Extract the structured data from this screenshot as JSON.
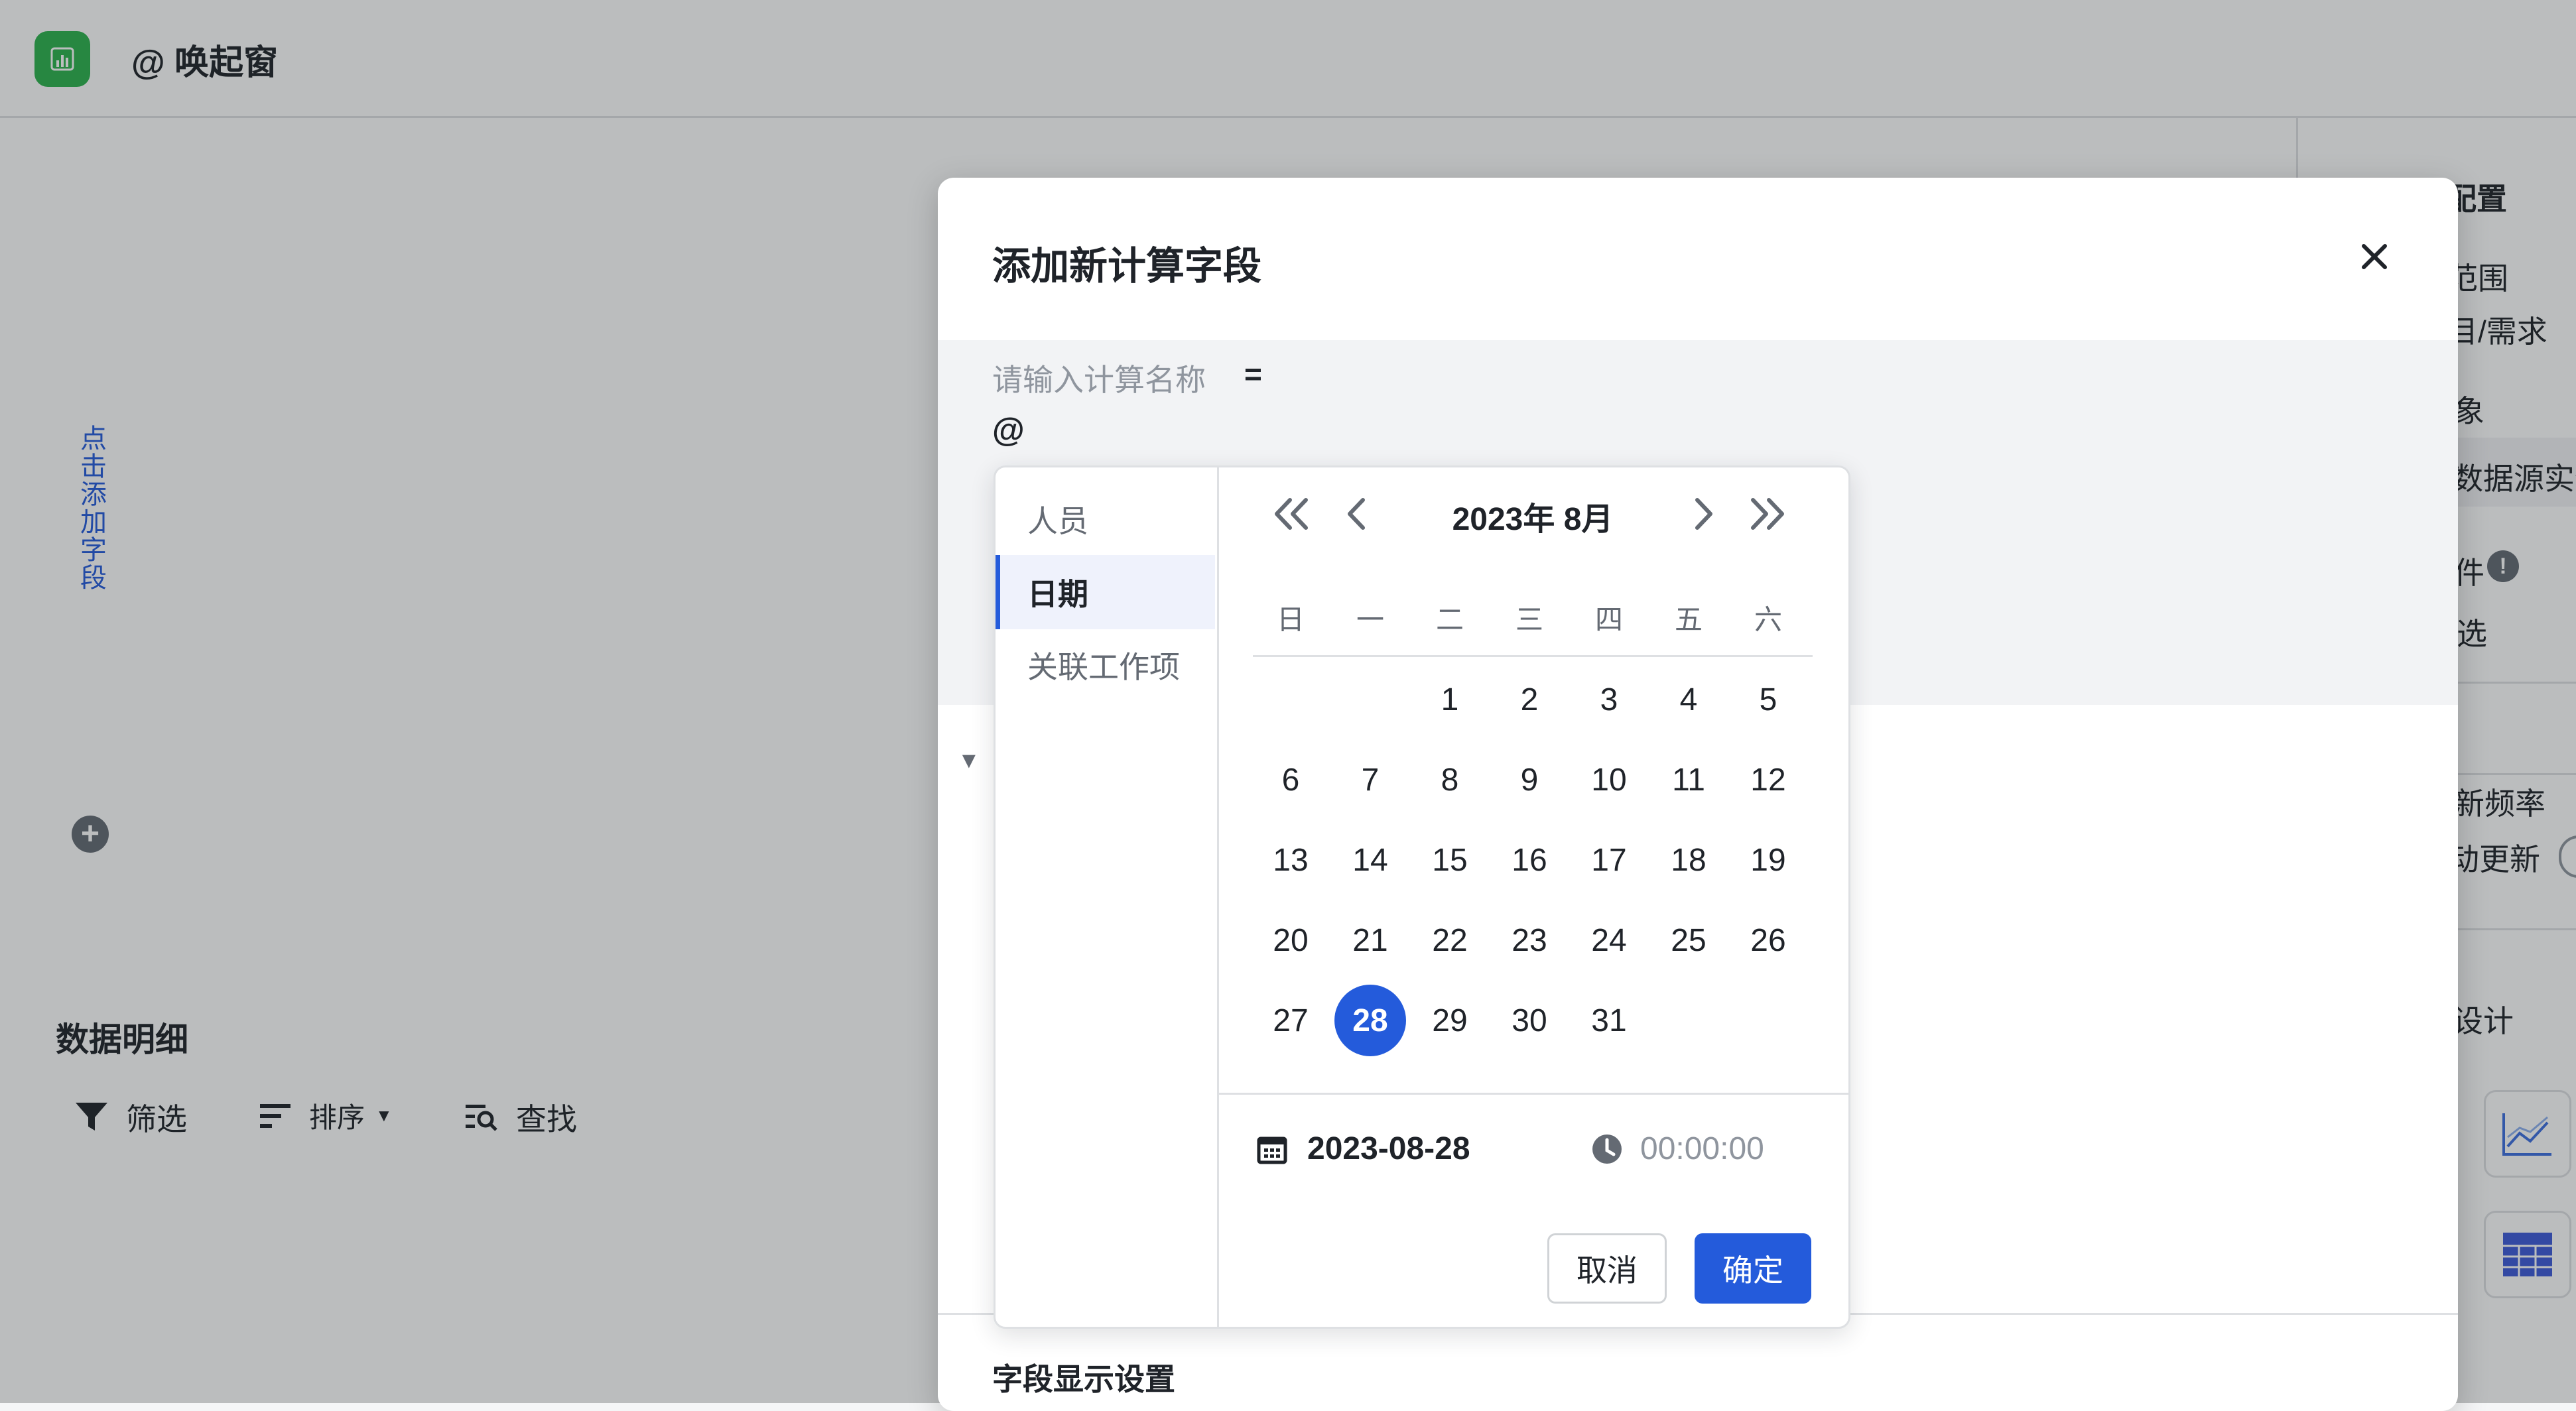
{
  "app": {
    "title": "@ 唤起窗"
  },
  "left_panel": {
    "add_field_vertical": "点击添加字段",
    "detail_title": "数据明细",
    "toolbar": {
      "filter": "筛选",
      "sort": "排序",
      "find": "查找"
    }
  },
  "right_panel": {
    "items": [
      "配置",
      "范围",
      "目/需求",
      "象",
      "数据源实例",
      "件",
      "选",
      "新频率",
      "动更新",
      "设计"
    ]
  },
  "modal": {
    "title": "添加新计算字段",
    "formula_name_placeholder": "请输入计算名称",
    "formula_equals": "=",
    "formula_text": "@",
    "section_title": "字段显示设置"
  },
  "popup": {
    "menu": [
      {
        "label": "人员",
        "active": false
      },
      {
        "label": "日期",
        "active": true
      },
      {
        "label": "关联工作项",
        "active": false
      }
    ],
    "calendar": {
      "title": "2023年 8月",
      "weekdays": [
        "日",
        "一",
        "二",
        "三",
        "四",
        "五",
        "六"
      ],
      "first_weekday_index": 2,
      "days_in_month": 31,
      "selected_day": 28,
      "selected_date": "2023-08-28",
      "time": "00:00:00"
    },
    "buttons": {
      "cancel": "取消",
      "ok": "确定"
    }
  },
  "colors": {
    "accent": "#245bdb",
    "logo_green": "#2bb24c"
  }
}
